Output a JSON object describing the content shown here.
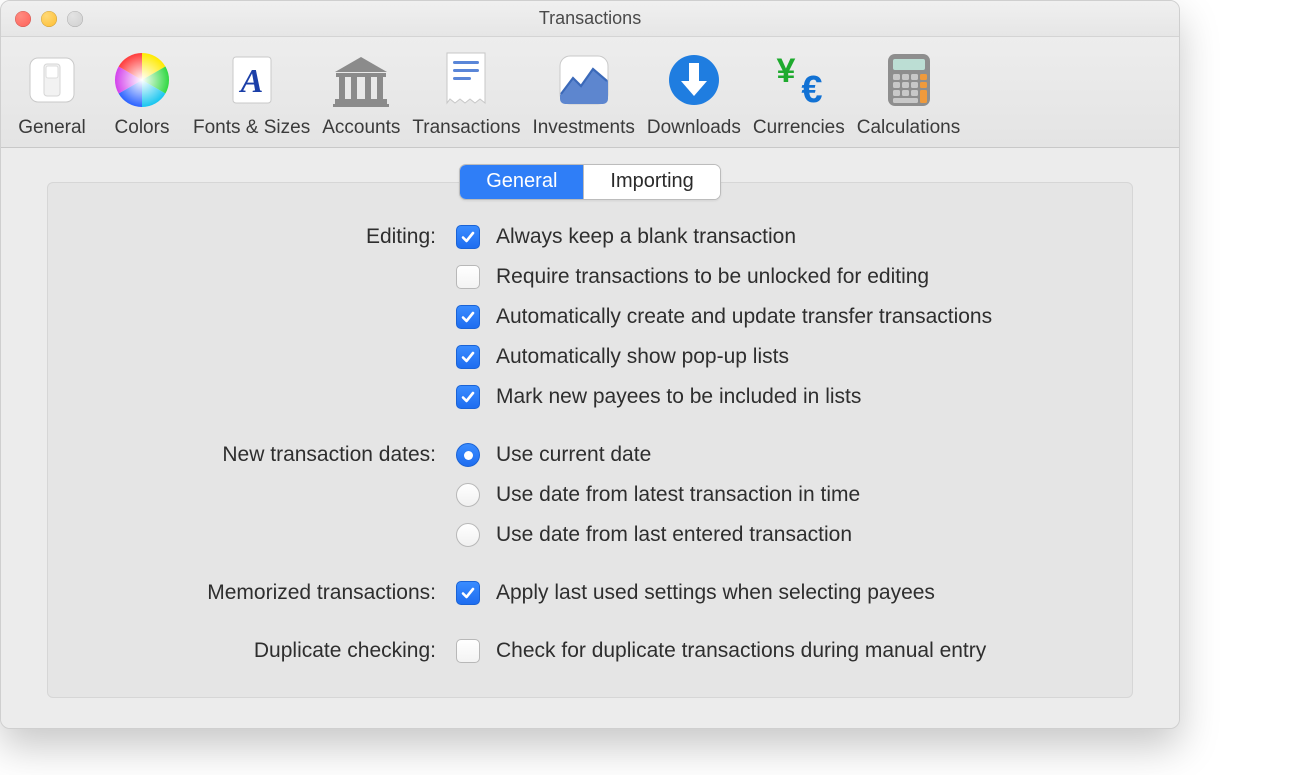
{
  "window": {
    "title": "Transactions"
  },
  "toolbar": {
    "items": [
      {
        "id": "general",
        "label": "General"
      },
      {
        "id": "colors",
        "label": "Colors"
      },
      {
        "id": "fonts",
        "label": "Fonts & Sizes"
      },
      {
        "id": "accounts",
        "label": "Accounts"
      },
      {
        "id": "transactions",
        "label": "Transactions"
      },
      {
        "id": "investments",
        "label": "Investments"
      },
      {
        "id": "downloads",
        "label": "Downloads"
      },
      {
        "id": "currencies",
        "label": "Currencies"
      },
      {
        "id": "calculations",
        "label": "Calculations"
      }
    ]
  },
  "tabs": {
    "general": "General",
    "importing": "Importing",
    "active": "general"
  },
  "sections": {
    "editing": {
      "label": "Editing:",
      "options": [
        {
          "label": "Always keep a blank transaction",
          "checked": true
        },
        {
          "label": "Require transactions to be unlocked for editing",
          "checked": false
        },
        {
          "label": "Automatically create and update transfer transactions",
          "checked": true
        },
        {
          "label": "Automatically show pop-up lists",
          "checked": true
        },
        {
          "label": "Mark new payees to be included in lists",
          "checked": true
        }
      ]
    },
    "dates": {
      "label": "New transaction dates:",
      "options": [
        {
          "label": "Use current date",
          "selected": true
        },
        {
          "label": "Use date from latest transaction in time",
          "selected": false
        },
        {
          "label": "Use date from last entered transaction",
          "selected": false
        }
      ]
    },
    "memorized": {
      "label": "Memorized transactions:",
      "option": {
        "label": "Apply last used settings when selecting payees",
        "checked": true
      }
    },
    "duplicate": {
      "label": "Duplicate checking:",
      "option": {
        "label": "Check for duplicate transactions during manual entry",
        "checked": false
      }
    }
  }
}
